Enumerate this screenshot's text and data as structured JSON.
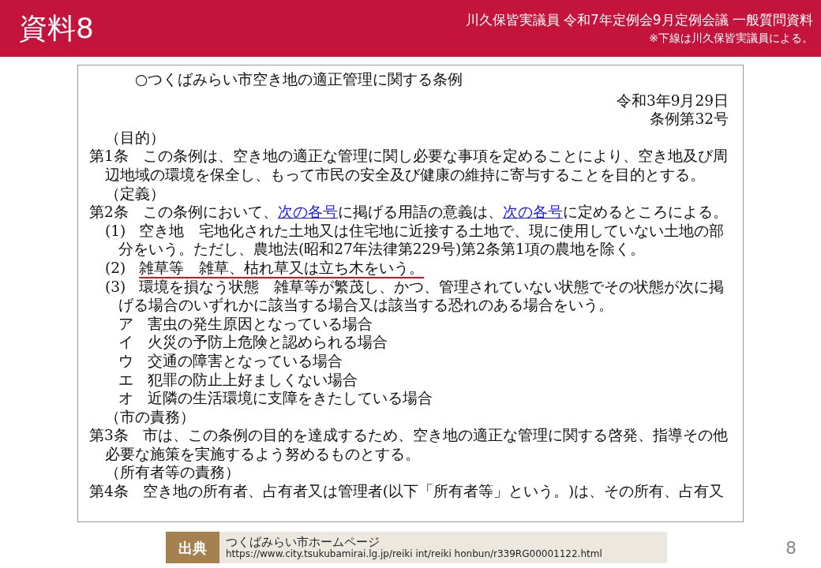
{
  "header": {
    "title": "資料8",
    "meeting": "川久保皆実議員 令和7年定例会9月定例会議 一般質問資料",
    "note": "※下線は川久保皆実議員による。"
  },
  "document": {
    "title": "○つくばみらい市空き地の適正管理に関する条例",
    "date": "令和3年9月29日",
    "number": "条例第32号",
    "blocks": [
      {
        "kind": "heading",
        "text": [
          {
            "text": "（目的）"
          }
        ]
      },
      {
        "kind": "article",
        "label": "第1条",
        "text": [
          {
            "text": "この条例は、空き地の適正な管理に関し必要な事項を定めることにより、空き地及び周辺地域の環境を保全し、もって市民の安全及び健康の維持に寄与することを目的とする。"
          }
        ]
      },
      {
        "kind": "heading",
        "text": [
          {
            "text": "（定義）"
          }
        ]
      },
      {
        "kind": "article",
        "label": "第2条",
        "text": [
          {
            "text": "この条例において、"
          },
          {
            "text": "次の各号",
            "link": true
          },
          {
            "text": "に掲げる用語の意義は、"
          },
          {
            "text": "次の各号",
            "link": true
          },
          {
            "text": "に定めるところによる。"
          }
        ]
      },
      {
        "kind": "item",
        "label": "(1)",
        "text": [
          {
            "text": "空き地　宅地化された土地又は住宅地に近接する土地で、現に使用していない土地の部分をいう。ただし、農地法(昭和27年法律第229号)第2条第1項の農地を除く。"
          }
        ]
      },
      {
        "kind": "item",
        "label": "(2)",
        "underlined": true,
        "text": [
          {
            "text": "雑草等　雑草、枯れ草又は立ち木をいう。"
          }
        ]
      },
      {
        "kind": "item",
        "label": "(3)",
        "text": [
          {
            "text": "環境を損なう状態　雑草等が繁茂し、かつ、管理されていない状態でその状態が次に掲げる場合のいずれかに該当する場合又は該当する恐れのある場合をいう。"
          }
        ]
      },
      {
        "kind": "subitem",
        "label": "ア",
        "text": [
          {
            "text": "害虫の発生原因となっている場合"
          }
        ]
      },
      {
        "kind": "subitem",
        "label": "イ",
        "text": [
          {
            "text": "火災の予防上危険と認められる場合"
          }
        ]
      },
      {
        "kind": "subitem",
        "label": "ウ",
        "text": [
          {
            "text": "交通の障害となっている場合"
          }
        ]
      },
      {
        "kind": "subitem",
        "label": "エ",
        "text": [
          {
            "text": "犯罪の防止上好ましくない場合"
          }
        ]
      },
      {
        "kind": "subitem",
        "label": "オ",
        "text": [
          {
            "text": "近隣の生活環境に支障をきたしている場合"
          }
        ]
      },
      {
        "kind": "heading",
        "text": [
          {
            "text": "（市の責務）"
          }
        ]
      },
      {
        "kind": "article",
        "label": "第3条",
        "text": [
          {
            "text": "市は、この条例の目的を達成するため、空き地の適正な管理に関する啓発、指導その他必要な施策を実施するよう努めるものとする。"
          }
        ]
      },
      {
        "kind": "heading",
        "text": [
          {
            "text": "（所有者等の責務）"
          }
        ]
      },
      {
        "kind": "article",
        "label": "第4条",
        "text": [
          {
            "text": "空き地の所有者、占有者又は管理者(以下「所有者等」という。)は、その所有、占有又"
          }
        ]
      }
    ]
  },
  "footer": {
    "source_label": "出典",
    "source_title": "つくばみらい市ホームページ",
    "source_url": "https://www.city.tsukubamirai.lg.jp/reiki int/reiki honbun/r339RG00001122.html",
    "page": "8"
  }
}
